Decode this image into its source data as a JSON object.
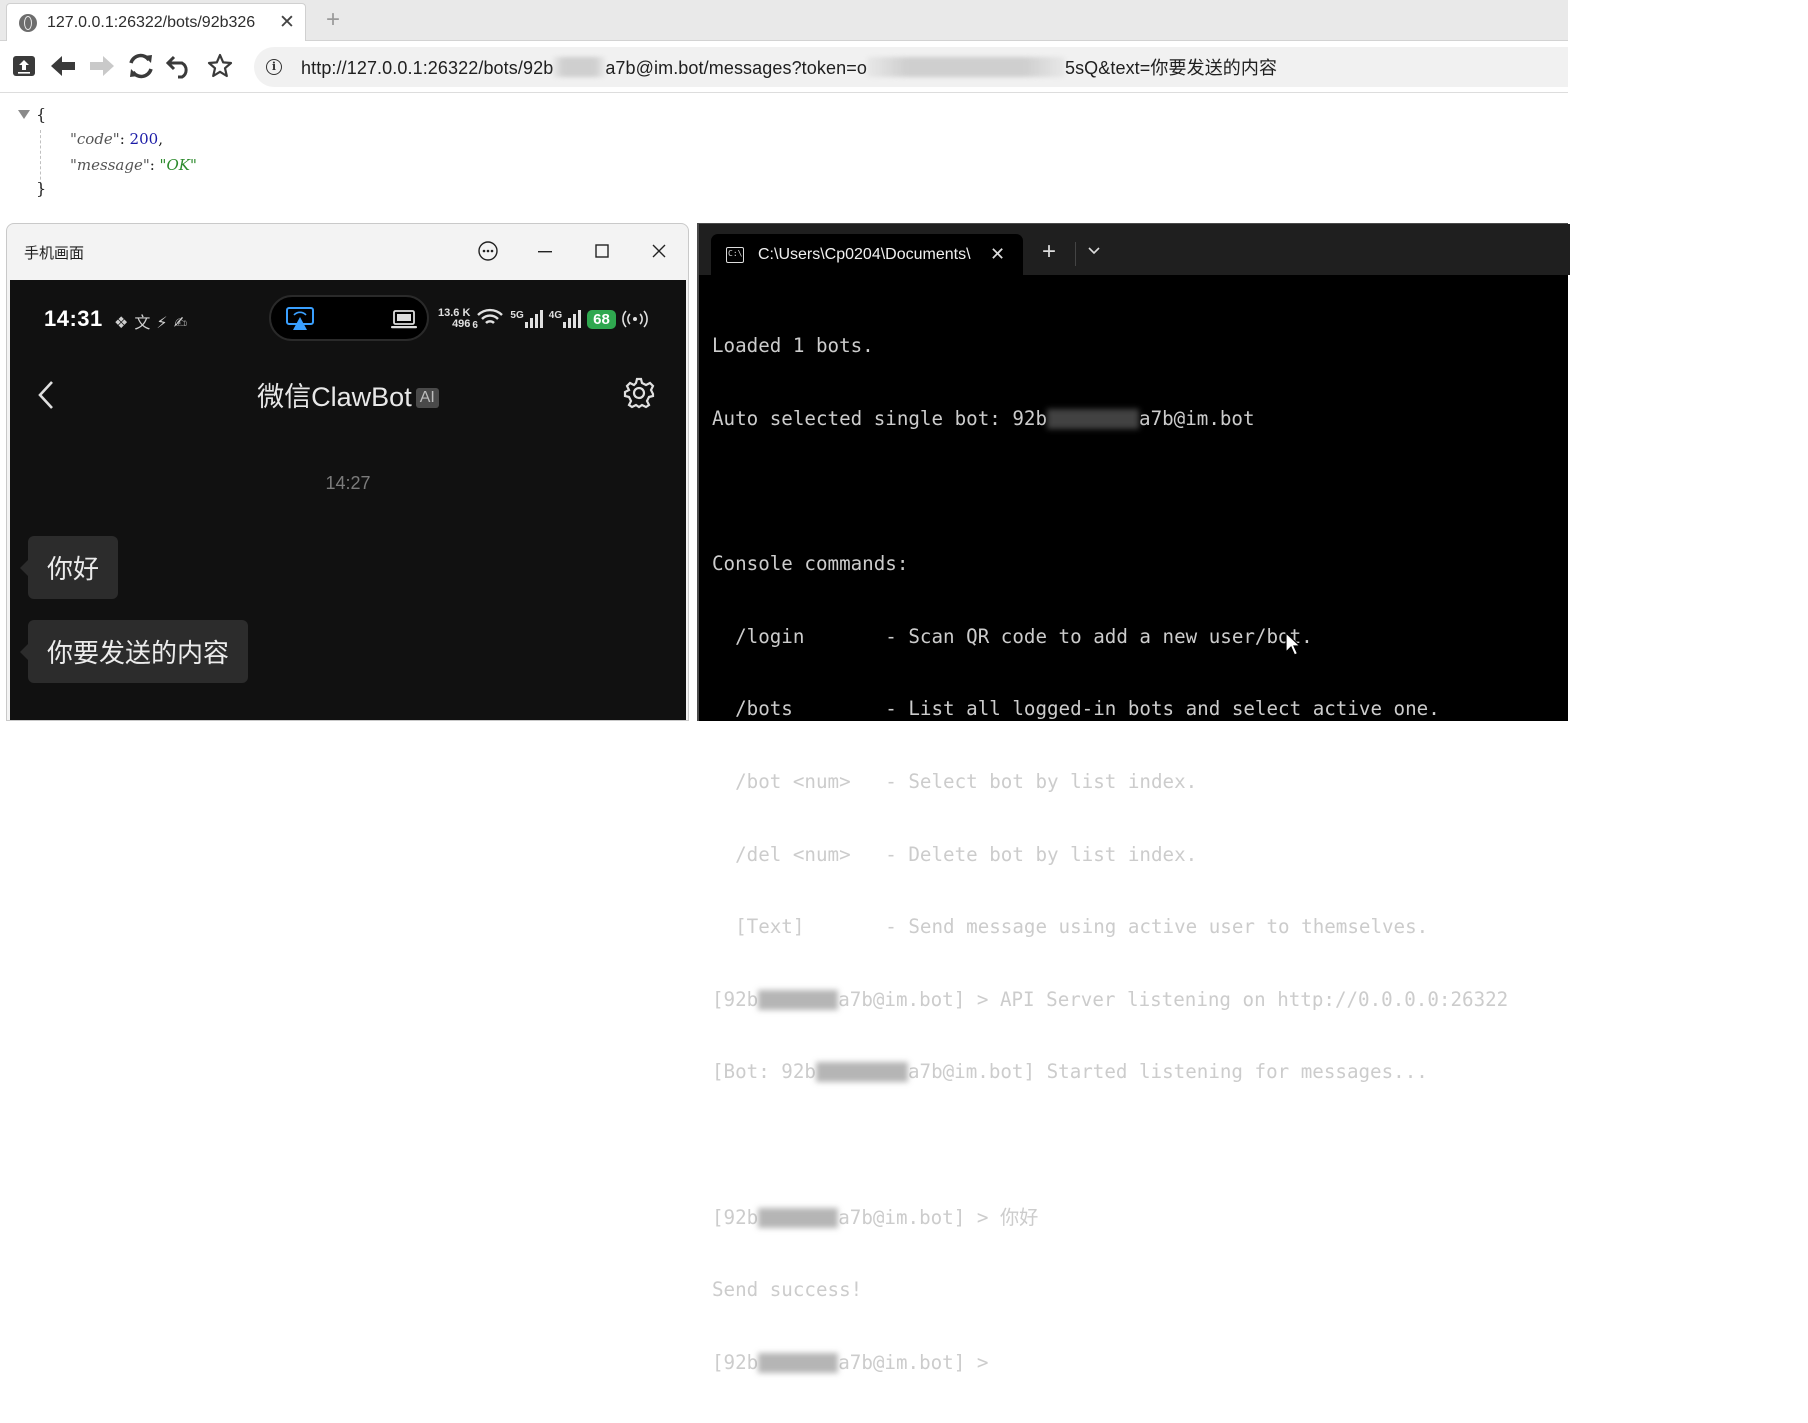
{
  "browser": {
    "tab_title": "127.0.0.1:26322/bots/92b326",
    "tab_close": "✕",
    "new_tab": "+",
    "url_prefix": "http://127.0.0.1:26322/bots/92b",
    "url_mid": "a7b@im.bot/messages?token=o",
    "url_suffix": "5sQ&text=你要发送的内容",
    "icons": [
      "upload-icon",
      "back-icon",
      "forward-icon",
      "reload-icon",
      "undo-icon",
      "star-icon",
      "info-icon",
      "globe-icon"
    ]
  },
  "json_view": {
    "open_brace": "{",
    "close_brace": "}",
    "code_key": "\"code\"",
    "code_value": "200",
    "message_key": "\"message\"",
    "message_value": "\"OK\""
  },
  "phone_window": {
    "title": "手机画面",
    "status_time": "14:31",
    "net_speed_top": "13.6 K",
    "net_speed_bottom": "496",
    "wifi_badge": "6",
    "signal1_label": "5G",
    "signal2_label": "4G",
    "battery": "68",
    "chat_title": "微信ClawBot",
    "ai_badge": "AI",
    "chat_time": "14:27",
    "messages": [
      "你好",
      "你要发送的内容"
    ]
  },
  "terminal": {
    "tab_title": "C:\\Users\\Cp0204\\Documents\\",
    "tab_close": "✕",
    "new_tab": "+",
    "lines": {
      "l1": "Loaded 1 bots.",
      "l2a": "Auto selected single bot: 92b",
      "l2b": "a7b@im.bot",
      "l4": "Console commands:",
      "l5": "  /login       - Scan QR code to add a new user/bot.",
      "l6": "  /bots        - List all logged-in bots and select active one.",
      "l7": "  /bot <num>   - Select bot by list index.",
      "l8": "  /del <num>   - Delete bot by list index.",
      "l9": "  [Text]       - Send message using active user to themselves.",
      "l10a": "[92b",
      "l10b": "a7b@im.bot] > API Server listening on http://0.0.0.0:26322",
      "l11a": "[Bot: 92b",
      "l11b": "a7b@im.bot] Started listening for messages...",
      "l13a": "[92b",
      "l13b": "a7b@im.bot] > 你好",
      "l14": "Send success!",
      "l15a": "[92b",
      "l15b": "a7b@im.bot] >"
    }
  },
  "colors": {
    "json_number": "#1a1aa6",
    "json_string": "#2c8a2c",
    "battery_green": "#2fa84f",
    "terminal_text": "#cccccc"
  }
}
